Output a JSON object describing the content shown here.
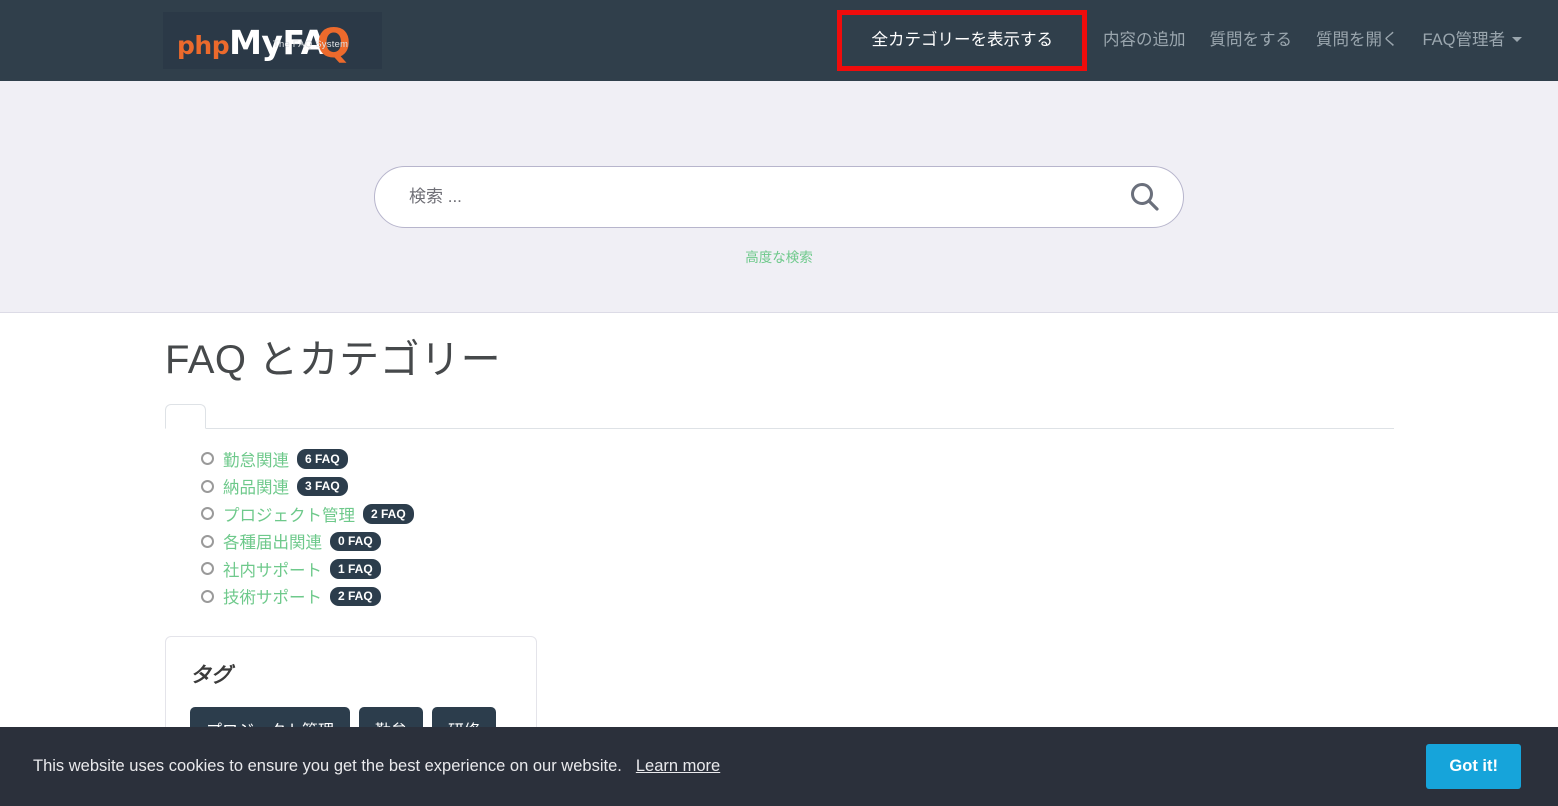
{
  "header": {
    "logo": {
      "php": "php",
      "my": "My",
      "faq": "FA",
      "qmark": "Q",
      "tagline": "The FAQ System",
      "alt": "phpMyFAQ - The FAQ System"
    },
    "nav": [
      {
        "label": "全カテゴリーを表示する",
        "active": true,
        "highlighted": true
      },
      {
        "label": "内容の追加",
        "active": false,
        "highlighted": false
      },
      {
        "label": "質問をする",
        "active": false,
        "highlighted": false
      },
      {
        "label": "質問を開く",
        "active": false,
        "highlighted": false
      },
      {
        "label": "FAQ管理者",
        "active": false,
        "highlighted": false,
        "dropdown": true
      }
    ]
  },
  "search": {
    "value": "",
    "placeholder": "検索 ...",
    "button_icon": "search-icon",
    "advanced_label": "高度な検索"
  },
  "main": {
    "title": "FAQ とカテゴリー",
    "tab_empty_label": "",
    "categories": [
      {
        "name": "勤怠関連",
        "badge": "6 FAQ"
      },
      {
        "name": "納品関連",
        "badge": "3 FAQ"
      },
      {
        "name": "プロジェクト管理",
        "badge": "2 FAQ"
      },
      {
        "name": "各種届出関連",
        "badge": "0 FAQ"
      },
      {
        "name": "社内サポート",
        "badge": "1 FAQ"
      },
      {
        "name": "技術サポート",
        "badge": "2 FAQ"
      }
    ],
    "tags": {
      "title": "タグ",
      "items": [
        "プロジェクト管理",
        "勤怠",
        "研修"
      ]
    }
  },
  "cookie": {
    "message": "This website uses cookies to ensure you get the best experience on our website.",
    "learn_more": "Learn more",
    "accept": "Got it!"
  },
  "colors": {
    "header_bg": "#303f4b",
    "hero_bg": "#f0eff5",
    "accent_green": "#6ec98b",
    "badge_navy": "#2c3d4c",
    "highlight_red": "#f00c0c",
    "cookie_bg": "#2b303b",
    "cookie_btn": "#16a4da",
    "logo_orange": "#ec6a2c"
  }
}
